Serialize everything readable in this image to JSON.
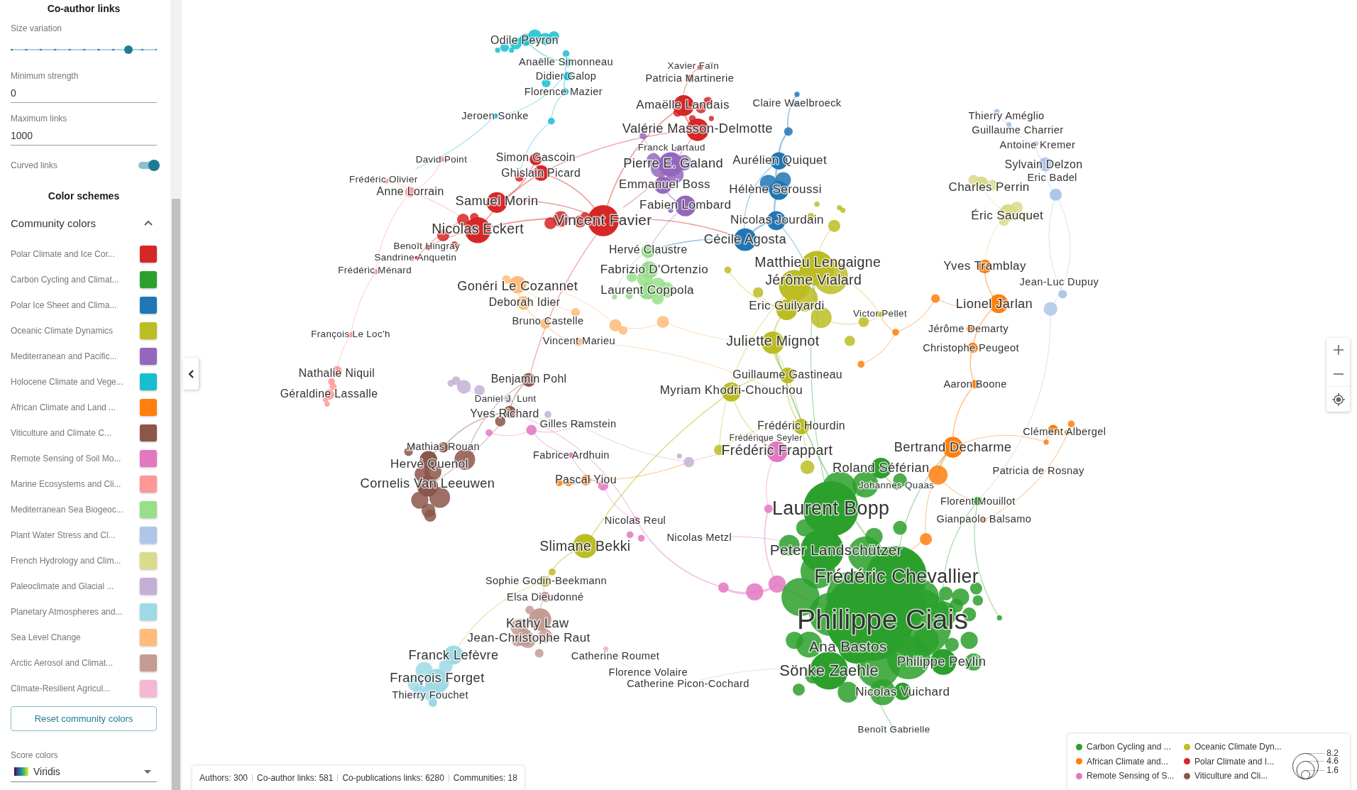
{
  "sidebar": {
    "co_author_links": {
      "title": "Co-author links",
      "size_variation": {
        "label": "Size variation",
        "level": 0.8
      },
      "minimum_strength": {
        "label": "Minimum strength",
        "value": "0"
      },
      "maximum_links": {
        "label": "Maximum links",
        "value": "1000"
      },
      "curved_links": {
        "label": "Curved links",
        "on": true
      }
    },
    "color_schemes": {
      "title": "Color schemes",
      "community_colors": {
        "label": "Community colors",
        "expanded": true,
        "communities": [
          {
            "name": "Polar Climate and Ice Cor...",
            "color": "#d62728"
          },
          {
            "name": "Carbon Cycling and Climat...",
            "color": "#2ca02c"
          },
          {
            "name": "Polar Ice Sheet and Clima...",
            "color": "#1f77b4"
          },
          {
            "name": "Oceanic Climate Dynamics",
            "color": "#bcbd22"
          },
          {
            "name": "Mediterranean and Pacific...",
            "color": "#9467bd"
          },
          {
            "name": "Holocene Climate and Vege...",
            "color": "#17becf"
          },
          {
            "name": "African Climate and Land ...",
            "color": "#ff7f0e"
          },
          {
            "name": "Viticulture and Climate C...",
            "color": "#8c564b"
          },
          {
            "name": "Remote Sensing of Soil Mo...",
            "color": "#e377c2"
          },
          {
            "name": "Marine Ecosystems and Cli...",
            "color": "#ff9896"
          },
          {
            "name": "Mediterranean Sea Biogeoc...",
            "color": "#98df8a"
          },
          {
            "name": "Plant Water Stress and Cl...",
            "color": "#aec7e8"
          },
          {
            "name": "French Hydrology and Clim...",
            "color": "#dbdb8d"
          },
          {
            "name": "Paleoclimate and Glacial ...",
            "color": "#c5b0d5"
          },
          {
            "name": "Planetary Atmospheres and...",
            "color": "#9edae5"
          },
          {
            "name": "Sea Level Change",
            "color": "#ffbb78"
          },
          {
            "name": "Arctic Aerosol and Climat...",
            "color": "#c49c94"
          },
          {
            "name": "Climate-Resilient Agricul...",
            "color": "#f7b6d2"
          }
        ],
        "reset_button": "Reset community colors"
      },
      "score_colors": {
        "label": "Score colors",
        "value": "Viridis"
      }
    }
  },
  "graph": {
    "nodes": [
      {
        "label": "Odile Peyron",
        "color": "#17becf"
      },
      {
        "label": "Anaëlle Simonneau",
        "color": "#17becf"
      },
      {
        "label": "Xavier Faïn",
        "color": "#d62728"
      },
      {
        "label": "Didier Galop",
        "color": "#17becf"
      },
      {
        "label": "Patricia Martinerie",
        "color": "#d62728"
      },
      {
        "label": "Florence Mazier",
        "color": "#17becf"
      },
      {
        "label": "Amaëlle Landais",
        "color": "#d62728"
      },
      {
        "label": "Claire Waelbroeck",
        "color": "#1f77b4"
      },
      {
        "label": "Jeroen Sonke",
        "color": "#17becf"
      },
      {
        "label": "Thierry Améglio",
        "color": "#aec7e8"
      },
      {
        "label": "Valérie Masson-Delmotte",
        "color": "#d62728"
      },
      {
        "label": "Guillaume Charrier",
        "color": "#aec7e8"
      },
      {
        "label": "Franck Lartaud",
        "color": "#9467bd"
      },
      {
        "label": "Antoine Kremer",
        "color": "#aec7e8"
      },
      {
        "label": "David Point",
        "color": "#ff9896"
      },
      {
        "label": "Simon Gascoin",
        "color": "#d62728"
      },
      {
        "label": "Pierre E. Galand",
        "color": "#9467bd"
      },
      {
        "label": "Aurélien Quiquet",
        "color": "#1f77b4"
      },
      {
        "label": "Sylvain Delzon",
        "color": "#aec7e8"
      },
      {
        "label": "Frédéric Olivier",
        "color": "#ff9896"
      },
      {
        "label": "Ghislain Picard",
        "color": "#d62728"
      },
      {
        "label": "Eric Badel",
        "color": "#aec7e8"
      },
      {
        "label": "Anne Lorrain",
        "color": "#ff9896"
      },
      {
        "label": "Emmanuel Boss",
        "color": "#9467bd"
      },
      {
        "label": "Hélène Seroussi",
        "color": "#1f77b4"
      },
      {
        "label": "Charles Perrin",
        "color": "#dbdb8d"
      },
      {
        "label": "Samuel Morin",
        "color": "#d62728"
      },
      {
        "label": "Fabien Lombard",
        "color": "#9467bd"
      },
      {
        "label": "Vincent Favier",
        "color": "#d62728"
      },
      {
        "label": "Nicolas Jourdain",
        "color": "#1f77b4"
      },
      {
        "label": "Éric Sauquet",
        "color": "#dbdb8d"
      },
      {
        "label": "Nicolas Eckert",
        "color": "#d62728"
      },
      {
        "label": "Cécile Agosta",
        "color": "#1f77b4"
      },
      {
        "label": "Benoît Hingray",
        "color": "#d62728"
      },
      {
        "label": "Hervé Claustre",
        "color": "#98df8a"
      },
      {
        "label": "Sandrine Anquetin",
        "color": "#d62728"
      },
      {
        "label": "Frédéric Ménard",
        "color": "#ff9896"
      },
      {
        "label": "Fabrizio D'Ortenzio",
        "color": "#98df8a"
      },
      {
        "label": "Matthieu Lengaigne",
        "color": "#bcbd22"
      },
      {
        "label": "Yves Tramblay",
        "color": "#ff7f0e"
      },
      {
        "label": "Gonéri Le Cozannet",
        "color": "#ffbb78"
      },
      {
        "label": "Laurent Coppola",
        "color": "#98df8a"
      },
      {
        "label": "Jérôme Vialard",
        "color": "#bcbd22"
      },
      {
        "label": "Jean-Luc Dupuy",
        "color": "#aec7e8"
      },
      {
        "label": "Deborah Idier",
        "color": "#ffbb78"
      },
      {
        "label": "Eric Guilyardi",
        "color": "#bcbd22"
      },
      {
        "label": "Lionel Jarlan",
        "color": "#ff7f0e"
      },
      {
        "label": "Victor Pellet",
        "color": "#bcbd22"
      },
      {
        "label": "Bruno Castelle",
        "color": "#ffbb78"
      },
      {
        "label": "François Le Loc'h",
        "color": "#ff9896"
      },
      {
        "label": "Jérôme Demarty",
        "color": "#ff7f0e"
      },
      {
        "label": "Vincent Marieu",
        "color": "#ffbb78"
      },
      {
        "label": "Juliette Mignot",
        "color": "#bcbd22"
      },
      {
        "label": "Christophe Peugeot",
        "color": "#ff7f0e"
      },
      {
        "label": "Nathalie Niquil",
        "color": "#ff9896"
      },
      {
        "label": "Benjamin Pohl",
        "color": "#8c564b"
      },
      {
        "label": "Guillaume Gastineau",
        "color": "#bcbd22"
      },
      {
        "label": "Aaron Boone",
        "color": "#ff7f0e"
      },
      {
        "label": "Géraldine Lassalle",
        "color": "#ff9896"
      },
      {
        "label": "Myriam Khodri-Chouchou",
        "color": "#bcbd22"
      },
      {
        "label": "Daniel J. Lunt",
        "color": "#c5b0d5"
      },
      {
        "label": "Yves Richard",
        "color": "#8c564b"
      },
      {
        "label": "Gilles Ramstein",
        "color": "#c5b0d5"
      },
      {
        "label": "Frédéric Hourdin",
        "color": "#bcbd22"
      },
      {
        "label": "Clément Albergel",
        "color": "#ff7f0e"
      },
      {
        "label": "Frédérique Seyler",
        "color": "#e377c2"
      },
      {
        "label": "Mathias Rouan",
        "color": "#8c564b"
      },
      {
        "label": "Fabrice Ardhuin",
        "color": "#e377c2"
      },
      {
        "label": "Frédéric Frappart",
        "color": "#e377c2"
      },
      {
        "label": "Bertrand Decharme",
        "color": "#ff7f0e"
      },
      {
        "label": "Hervé Quenol",
        "color": "#8c564b"
      },
      {
        "label": "Roland Séférian",
        "color": "#2ca02c"
      },
      {
        "label": "Patricia de Rosnay",
        "color": "#ff7f0e"
      },
      {
        "label": "Cornelis Van Leeuwen",
        "color": "#8c564b"
      },
      {
        "label": "Pascal Yiou",
        "color": "#ff7f0e"
      },
      {
        "label": "Johannes Quaas",
        "color": "#2ca02c"
      },
      {
        "label": "Laurent Bopp",
        "color": "#2ca02c"
      },
      {
        "label": "Florent Mouillot",
        "color": "#2ca02c"
      },
      {
        "label": "Nicolas Reul",
        "color": "#e377c2"
      },
      {
        "label": "Gianpaolo Balsamo",
        "color": "#ff7f0e"
      },
      {
        "label": "Nicolas Metzl",
        "color": "#e377c2"
      },
      {
        "label": "Slimane Bekki",
        "color": "#bcbd22"
      },
      {
        "label": "Peter Landschützer",
        "color": "#2ca02c"
      },
      {
        "label": "Sophie Godin-Beekmann",
        "color": "#bcbd22"
      },
      {
        "label": "Frédéric Chevallier",
        "color": "#2ca02c"
      },
      {
        "label": "Elsa Dieudonné",
        "color": "#c49c94"
      },
      {
        "label": "Kathy Law",
        "color": "#c49c94"
      },
      {
        "label": "Philippe Ciais",
        "color": "#2ca02c"
      },
      {
        "label": "Jean-Christophe Raut",
        "color": "#c49c94"
      },
      {
        "label": "Ana Bastos",
        "color": "#2ca02c"
      },
      {
        "label": "Franck Lefèvre",
        "color": "#9edae5"
      },
      {
        "label": "Catherine Roumet",
        "color": "#f7b6d2"
      },
      {
        "label": "Philippe Peylin",
        "color": "#2ca02c"
      },
      {
        "label": "François Forget",
        "color": "#9edae5"
      },
      {
        "label": "Florence Volaire",
        "color": "#f7b6d2"
      },
      {
        "label": "Catherine Picon-Cochard",
        "color": "#f7b6d2"
      },
      {
        "label": "Sönke Zaehle",
        "color": "#2ca02c"
      },
      {
        "label": "Thierry Fouchet",
        "color": "#9edae5"
      },
      {
        "label": "Nicolas Vuichard",
        "color": "#2ca02c"
      },
      {
        "label": "Benoît Gabrielle",
        "color": "#2ca02c"
      }
    ]
  },
  "status_bar": {
    "items": [
      "Authors: 300",
      "Co-author links: 581",
      "Co-publications links: 6280",
      "Communities: 18"
    ]
  },
  "legend": {
    "communities": [
      {
        "label": "Carbon Cycling and ...",
        "color": "#2ca02c"
      },
      {
        "label": "Oceanic Climate Dyn...",
        "color": "#bcbd22"
      },
      {
        "label": "African Climate and...",
        "color": "#ff7f0e"
      },
      {
        "label": "Polar Climate and I...",
        "color": "#d62728"
      },
      {
        "label": "Remote Sensing of S...",
        "color": "#e377c2"
      },
      {
        "label": "Viticulture and Cli...",
        "color": "#8c564b"
      }
    ],
    "size_scale": [
      "8.2",
      "4.6",
      "1.6"
    ]
  }
}
